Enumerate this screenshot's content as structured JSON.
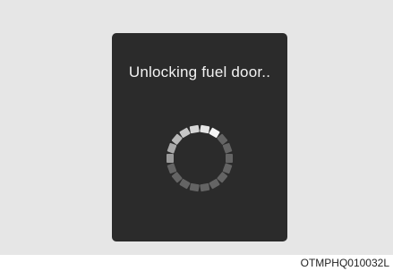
{
  "display": {
    "message": "Unlocking fuel door..",
    "background_color": "#2b2b2b",
    "text_color": "#f2f2f2"
  },
  "loading_indicator": {
    "icon": "loading-spinner-icon",
    "segment_count": 18,
    "bright_segment_color": "#f5f5f5",
    "dim_segment_color": "#6e6e6e"
  },
  "caption": "OTMPHQ010032L",
  "frame_color": "#e6e6e6"
}
